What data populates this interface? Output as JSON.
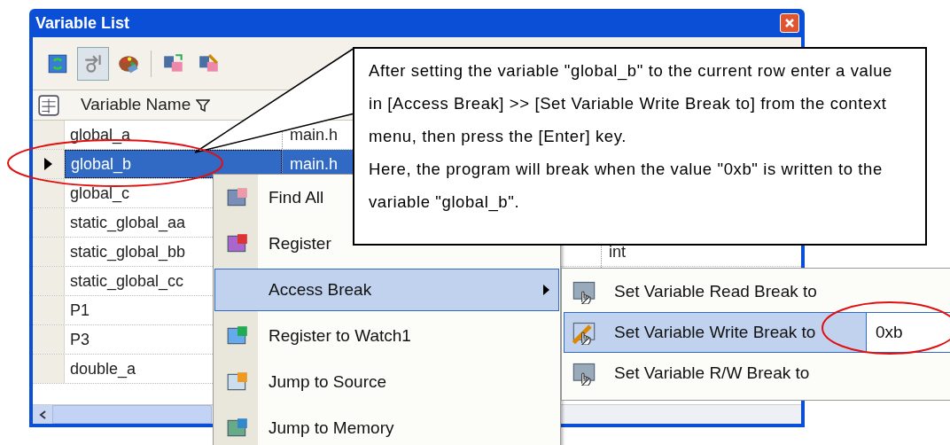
{
  "window": {
    "title": "Variable List"
  },
  "toolbar": [
    {
      "pressed": false
    },
    {
      "pressed": true
    },
    {
      "pressed": false
    },
    {
      "pressed": false
    },
    {
      "pressed": false
    }
  ],
  "table": {
    "columns": [
      "Variable Name"
    ],
    "rows": [
      {
        "name": "global_a",
        "file": "main.h",
        "selected": false
      },
      {
        "name": "global_b",
        "file": "main.h",
        "selected": true
      },
      {
        "name": "global_c",
        "selected": false
      },
      {
        "name": "static_global_aa",
        "selected": false
      },
      {
        "name": "static_global_bb",
        "type": "int",
        "selected": false
      },
      {
        "name": "static_global_cc",
        "selected": false
      },
      {
        "name": "P1",
        "selected": false
      },
      {
        "name": "P3",
        "selected": false
      },
      {
        "name": "double_a",
        "selected": false
      }
    ]
  },
  "context_menu": [
    {
      "label": "Find All",
      "selected": false,
      "submenu": false
    },
    {
      "label": "Register",
      "selected": false,
      "submenu": false
    },
    {
      "label": "Access Break",
      "selected": true,
      "submenu": true
    },
    {
      "label": "Register to Watch1",
      "selected": false,
      "submenu": false
    },
    {
      "label": "Jump to Source",
      "selected": false,
      "submenu": false
    },
    {
      "label": "Jump to Memory",
      "selected": false,
      "submenu": false
    }
  ],
  "submenu": [
    {
      "label": "Set Variable Read Break to",
      "selected": false
    },
    {
      "label": "Set Variable Write Break to",
      "selected": true,
      "value": "0xb"
    },
    {
      "label": "Set Variable R/W Break to",
      "selected": false
    }
  ],
  "callout": [
    "After setting the variable \"global_b\" to the current row enter a value in [Access Break] >> [Set Variable Write Break to] from the context menu, then press the [Enter] key.",
    "Here, the program will break when the value \"0xb\" is written to the variable \"global_b\"."
  ]
}
